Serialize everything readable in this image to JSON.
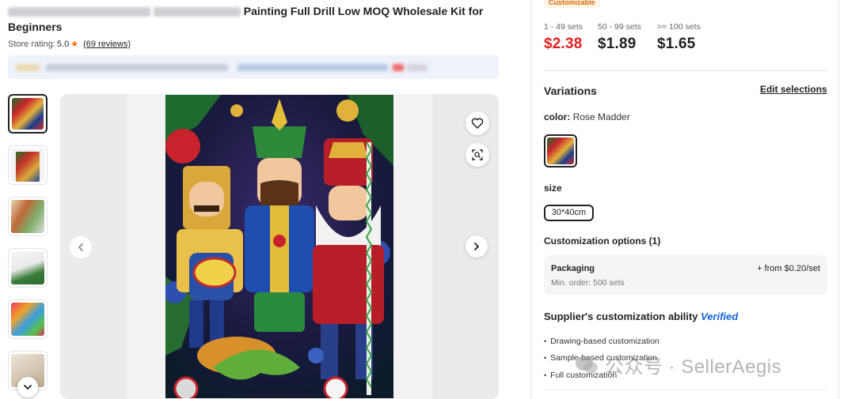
{
  "product": {
    "title": "Painting Full Drill Low MOQ Wholesale Kit for Beginners",
    "rating_label": "Store rating:",
    "rating_value": "5.0",
    "reviews": "(69 reviews)"
  },
  "gallery": {
    "thumbnails": [
      "thumb-1",
      "thumb-2",
      "thumb-3",
      "thumb-4",
      "thumb-5",
      "thumb-6"
    ],
    "selected_index": 0
  },
  "pricing": {
    "badge": "Customizable",
    "tiers": [
      {
        "range": "1 - 49 sets",
        "price": "$2.38"
      },
      {
        "range": "50 - 99 sets",
        "price": "$1.89"
      },
      {
        "range": ">= 100 sets",
        "price": "$1.65"
      }
    ],
    "highlight_color": "#e02020"
  },
  "variations": {
    "title": "Variations",
    "edit_label": "Edit selections",
    "color_key": "color:",
    "color_value": "Rose Madder",
    "size_key": "size",
    "size_value": "30*40cm"
  },
  "customization": {
    "title": "Customization options (1)",
    "option_name": "Packaging",
    "option_min": "Min. order: 500 sets",
    "option_price": "+ from $0.20/set"
  },
  "ability": {
    "title": "Supplier's customization ability",
    "verified": "Verified",
    "items": [
      "Drawing-based customization",
      "Sample-based customization",
      "Full customization"
    ]
  },
  "watermark": {
    "text": "公众号 · SellerAegis"
  }
}
